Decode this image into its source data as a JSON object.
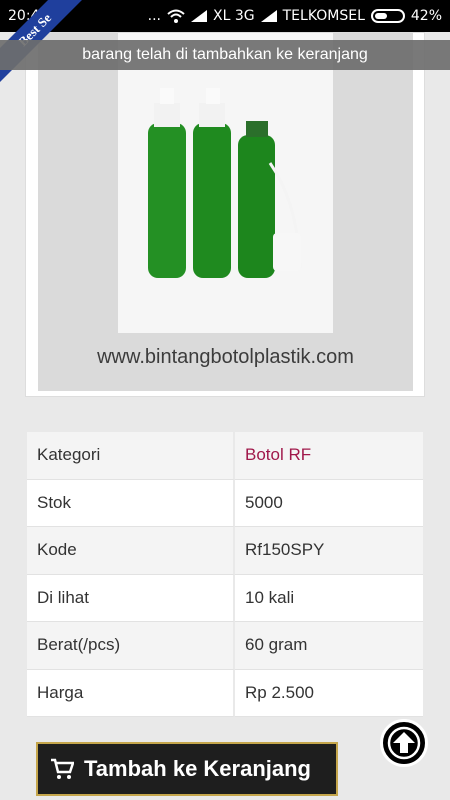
{
  "status_bar": {
    "time": "20:41",
    "dots": "...",
    "carrier1": "XL 3G",
    "carrier2": "TELKOMSEL",
    "battery": "42%",
    "icons": [
      "wifi-icon",
      "signal-icon",
      "signal-icon",
      "battery-icon"
    ]
  },
  "toast": {
    "text": "barang telah di tambahkan ke keranjang"
  },
  "product_image": {
    "badge": "Best Se",
    "watermark": "www.bintangbotolplastik.com"
  },
  "details": [
    {
      "label": "Kategori",
      "value": "Botol RF",
      "is_link": true
    },
    {
      "label": "Stok",
      "value": "5000"
    },
    {
      "label": "Kode",
      "value": "Rf150SPY"
    },
    {
      "label": "Di lihat",
      "value": "10 kali"
    },
    {
      "label": "Berat(/pcs)",
      "value": "60 gram"
    },
    {
      "label": "Harga",
      "value": "Rp 2.500"
    }
  ],
  "actions": {
    "add_to_cart": "Tambah ke Keranjang",
    "scroll_top_icon": "arrow-up-circle-icon",
    "cart_icon": "cart-icon"
  },
  "colors": {
    "link": "#a0184a",
    "ribbon": "#1f3f9d",
    "button_bg": "#1e1e1e",
    "button_border": "#c5a64c"
  }
}
